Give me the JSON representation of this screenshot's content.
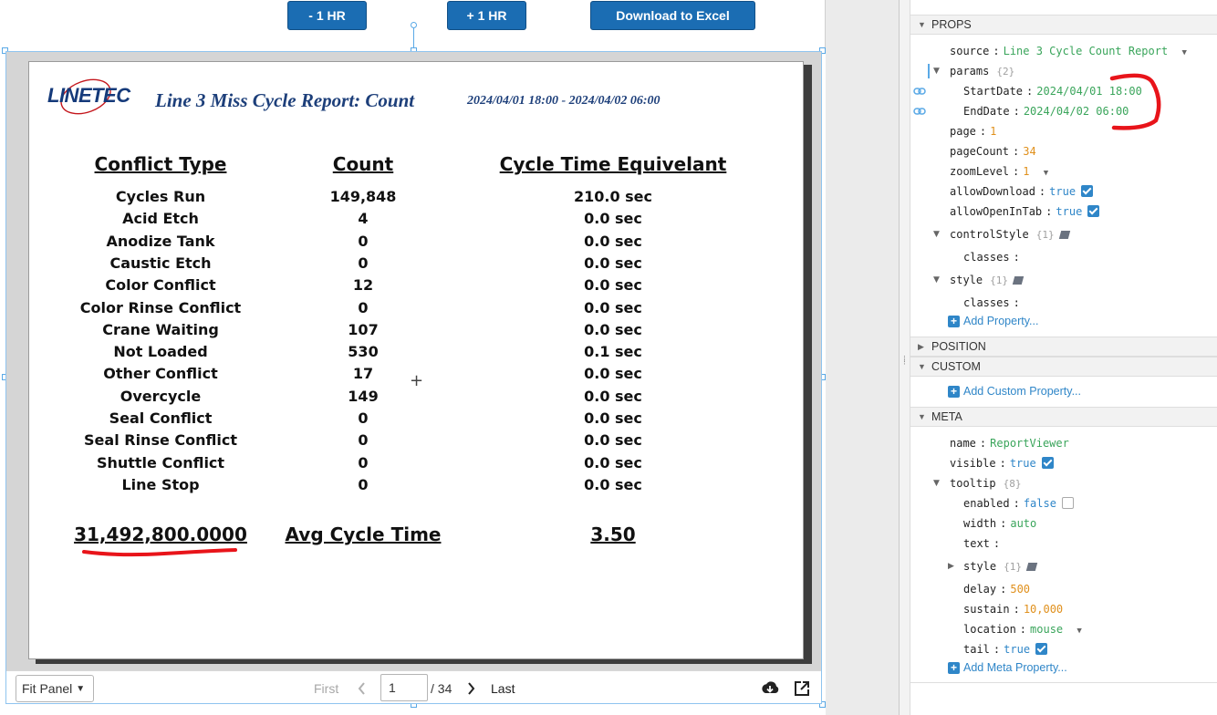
{
  "toolbar": {
    "minus_hr": "- 1 HR",
    "plus_hr": "+ 1 HR",
    "download_excel": "Download to Excel"
  },
  "report": {
    "logo_text": "LINETEC",
    "title": "Line 3 Miss Cycle Report: Count",
    "date_range": "2024/04/01 18:00 - 2024/04/02 06:00",
    "headers": [
      "Conflict Type",
      "Count",
      "Cycle Time Equivelant"
    ],
    "rows": [
      {
        "type": "Cycles Run",
        "count": "149,848",
        "cte": "210.0 sec"
      },
      {
        "type": "Acid Etch",
        "count": "4",
        "cte": "0.0 sec"
      },
      {
        "type": "Anodize Tank",
        "count": "0",
        "cte": "0.0 sec"
      },
      {
        "type": "Caustic Etch",
        "count": "0",
        "cte": "0.0 sec"
      },
      {
        "type": "Color Conflict",
        "count": "12",
        "cte": "0.0 sec"
      },
      {
        "type": "Color Rinse Conflict",
        "count": "0",
        "cte": "0.0 sec"
      },
      {
        "type": "Crane Waiting",
        "count": "107",
        "cte": "0.0 sec"
      },
      {
        "type": "Not Loaded",
        "count": "530",
        "cte": "0.1 sec"
      },
      {
        "type": "Other Conflict",
        "count": "17",
        "cte": "0.0 sec"
      },
      {
        "type": "Overcycle",
        "count": "149",
        "cte": "0.0 sec"
      },
      {
        "type": "Seal Conflict",
        "count": "0",
        "cte": "0.0 sec"
      },
      {
        "type": "Seal Rinse Conflict",
        "count": "0",
        "cte": "0.0 sec"
      },
      {
        "type": "Shuttle Conflict",
        "count": "0",
        "cte": "0.0 sec"
      },
      {
        "type": "Line Stop",
        "count": "0",
        "cte": "0.0 sec"
      }
    ],
    "footer": {
      "total": "31,492,800.0000",
      "avg_label": "Avg Cycle Time",
      "avg_value": "3.50"
    }
  },
  "viewer_bar": {
    "fit": "Fit Panel",
    "first": "First",
    "page": "1",
    "of_pages": "/ 34",
    "last": "Last"
  },
  "panel": {
    "props_header": "PROPS",
    "position_header": "POSITION",
    "custom_header": "CUSTOM",
    "meta_header": "META",
    "props": {
      "source_key": "source",
      "source_val": "Line 3 Cycle Count Report",
      "params_key": "params",
      "params_count": "{2}",
      "startdate_key": "StartDate",
      "startdate_val": "2024/04/01 18:00",
      "enddate_key": "EndDate",
      "enddate_val": "2024/04/02 06:00",
      "page_key": "page",
      "page_val": "1",
      "pagecount_key": "pageCount",
      "pagecount_val": "34",
      "zoom_key": "zoomLevel",
      "zoom_val": "1",
      "allowdl_key": "allowDownload",
      "allowdl_val": "true",
      "allowtab_key": "allowOpenInTab",
      "allowtab_val": "true",
      "controlstyle_key": "controlStyle",
      "controlstyle_count": "{1}",
      "classes_key": "classes",
      "style_key": "style",
      "style_count": "{1}",
      "classes2_key": "classes",
      "add_property": "Add Property..."
    },
    "add_custom": "Add Custom Property...",
    "meta": {
      "name_key": "name",
      "name_val": "ReportViewer",
      "visible_key": "visible",
      "visible_val": "true",
      "tooltip_key": "tooltip",
      "tooltip_count": "{8}",
      "enabled_key": "enabled",
      "enabled_val": "false",
      "width_key": "width",
      "width_val": "auto",
      "text_key": "text",
      "style_key": "style",
      "style_count": "{1}",
      "delay_key": "delay",
      "delay_val": "500",
      "sustain_key": "sustain",
      "sustain_val": "10,000",
      "location_key": "location",
      "location_val": "mouse",
      "tail_key": "tail",
      "tail_val": "true",
      "add_meta": "Add Meta Property..."
    }
  },
  "colors": {
    "button_blue": "#1b6db3",
    "title_navy": "#1d3f7a",
    "string_green": "#3aa55b",
    "number_orange": "#e0901c",
    "bool_blue": "#2f86c8",
    "annotation_red": "#e8141a"
  }
}
